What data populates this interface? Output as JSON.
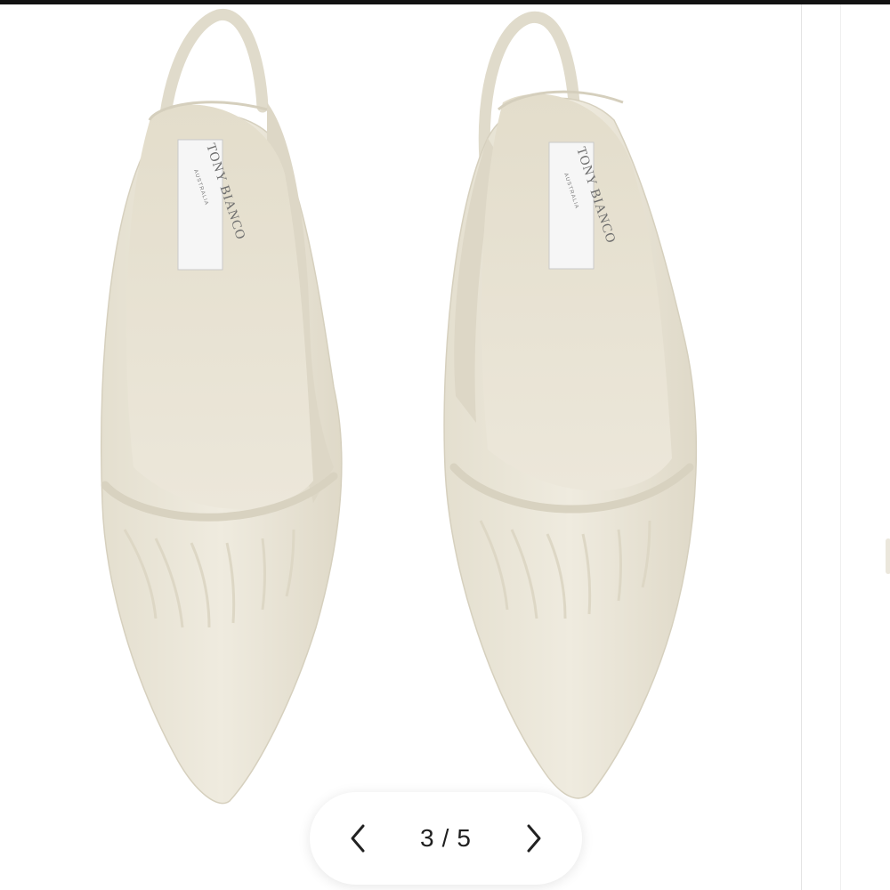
{
  "product": {
    "brand_label": "TONY BIANCO",
    "brand_sublabel": "AUSTRALIA",
    "image_alt": "Cream pointed-toe slingback heels, top view"
  },
  "gallery": {
    "current": "3",
    "separator": "/",
    "total": "5",
    "prev_icon": "chevron-left-icon",
    "next_icon": "chevron-right-icon"
  },
  "colors": {
    "shoe_leather": "#ebe6d8",
    "insole": "#e6e0cf",
    "top_bar": "#121212"
  }
}
